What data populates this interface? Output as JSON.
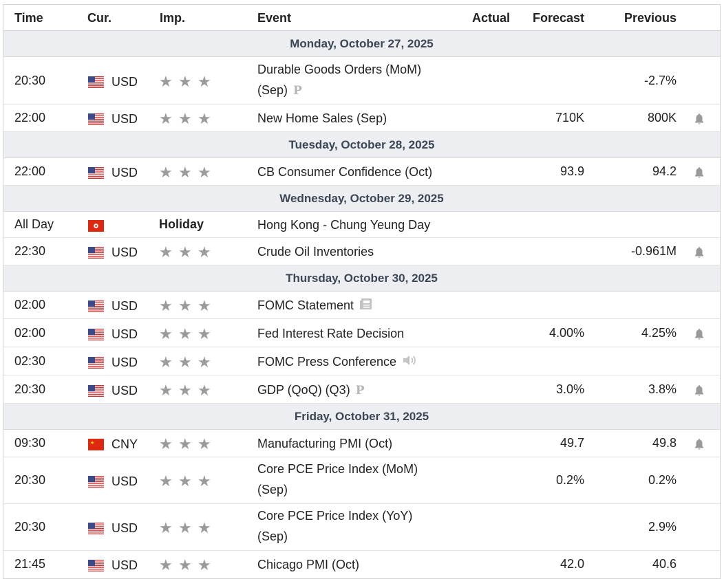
{
  "header": {
    "time": "Time",
    "cur": "Cur.",
    "imp": "Imp.",
    "event": "Event",
    "actual": "Actual",
    "forecast": "Forecast",
    "previous": "Previous"
  },
  "colors": {
    "date_bg": "#eceef1",
    "star": "#9b9b9b",
    "border": "#d4d4d4"
  },
  "groups": [
    {
      "date": "Monday, October 27, 2025",
      "rows": [
        {
          "time": "20:30",
          "flag": "us-flag",
          "currency": "USD",
          "importance": 3,
          "event": "Durable Goods Orders (MoM) (Sep)",
          "icon": "preliminary-icon",
          "actual": "",
          "forecast": "",
          "previous": "-2.7%",
          "bell": false
        },
        {
          "time": "22:00",
          "flag": "us-flag",
          "currency": "USD",
          "importance": 3,
          "event": "New Home Sales (Sep)",
          "icon": "",
          "actual": "",
          "forecast": "710K",
          "previous": "800K",
          "bell": true
        }
      ]
    },
    {
      "date": "Tuesday, October 28, 2025",
      "rows": [
        {
          "time": "22:00",
          "flag": "us-flag",
          "currency": "USD",
          "importance": 3,
          "event": "CB Consumer Confidence (Oct)",
          "icon": "",
          "actual": "",
          "forecast": "93.9",
          "previous": "94.2",
          "bell": true
        }
      ]
    },
    {
      "date": "Wednesday, October 29, 2025",
      "rows": [
        {
          "time": "All Day",
          "flag": "hk-flag",
          "currency": "",
          "importance": 0,
          "holiday": "Holiday",
          "event": "Hong Kong - Chung Yeung Day",
          "icon": "",
          "actual": "",
          "forecast": "",
          "previous": "",
          "bell": false
        },
        {
          "time": "22:30",
          "flag": "us-flag",
          "currency": "USD",
          "importance": 3,
          "event": "Crude Oil Inventories",
          "icon": "",
          "actual": "",
          "forecast": "",
          "previous": "-0.961M",
          "bell": true
        }
      ]
    },
    {
      "date": "Thursday, October 30, 2025",
      "rows": [
        {
          "time": "02:00",
          "flag": "us-flag",
          "currency": "USD",
          "importance": 3,
          "event": "FOMC Statement",
          "icon": "document-icon",
          "actual": "",
          "forecast": "",
          "previous": "",
          "bell": false
        },
        {
          "time": "02:00",
          "flag": "us-flag",
          "currency": "USD",
          "importance": 3,
          "event": "Fed Interest Rate Decision",
          "icon": "",
          "actual": "",
          "forecast": "4.00%",
          "previous": "4.25%",
          "bell": true
        },
        {
          "time": "02:30",
          "flag": "us-flag",
          "currency": "USD",
          "importance": 3,
          "event": "FOMC Press Conference",
          "icon": "speaker-icon",
          "actual": "",
          "forecast": "",
          "previous": "",
          "bell": false
        },
        {
          "time": "20:30",
          "flag": "us-flag",
          "currency": "USD",
          "importance": 3,
          "event": "GDP (QoQ) (Q3)",
          "icon": "preliminary-icon",
          "actual": "",
          "forecast": "3.0%",
          "previous": "3.8%",
          "bell": true
        }
      ]
    },
    {
      "date": "Friday, October 31, 2025",
      "rows": [
        {
          "time": "09:30",
          "flag": "cn-flag",
          "currency": "CNY",
          "importance": 3,
          "event": "Manufacturing PMI (Oct)",
          "icon": "",
          "actual": "",
          "forecast": "49.7",
          "previous": "49.8",
          "bell": true
        },
        {
          "time": "20:30",
          "flag": "us-flag",
          "currency": "USD",
          "importance": 3,
          "event": "Core PCE Price Index (MoM) (Sep)",
          "icon": "",
          "actual": "",
          "forecast": "0.2%",
          "previous": "0.2%",
          "bell": false
        },
        {
          "time": "20:30",
          "flag": "us-flag",
          "currency": "USD",
          "importance": 3,
          "event": "Core PCE Price Index (YoY) (Sep)",
          "icon": "",
          "actual": "",
          "forecast": "",
          "previous": "2.9%",
          "bell": false
        },
        {
          "time": "21:45",
          "flag": "us-flag",
          "currency": "USD",
          "importance": 3,
          "event": "Chicago PMI (Oct)",
          "icon": "",
          "actual": "",
          "forecast": "42.0",
          "previous": "40.6",
          "bell": false
        }
      ]
    }
  ]
}
